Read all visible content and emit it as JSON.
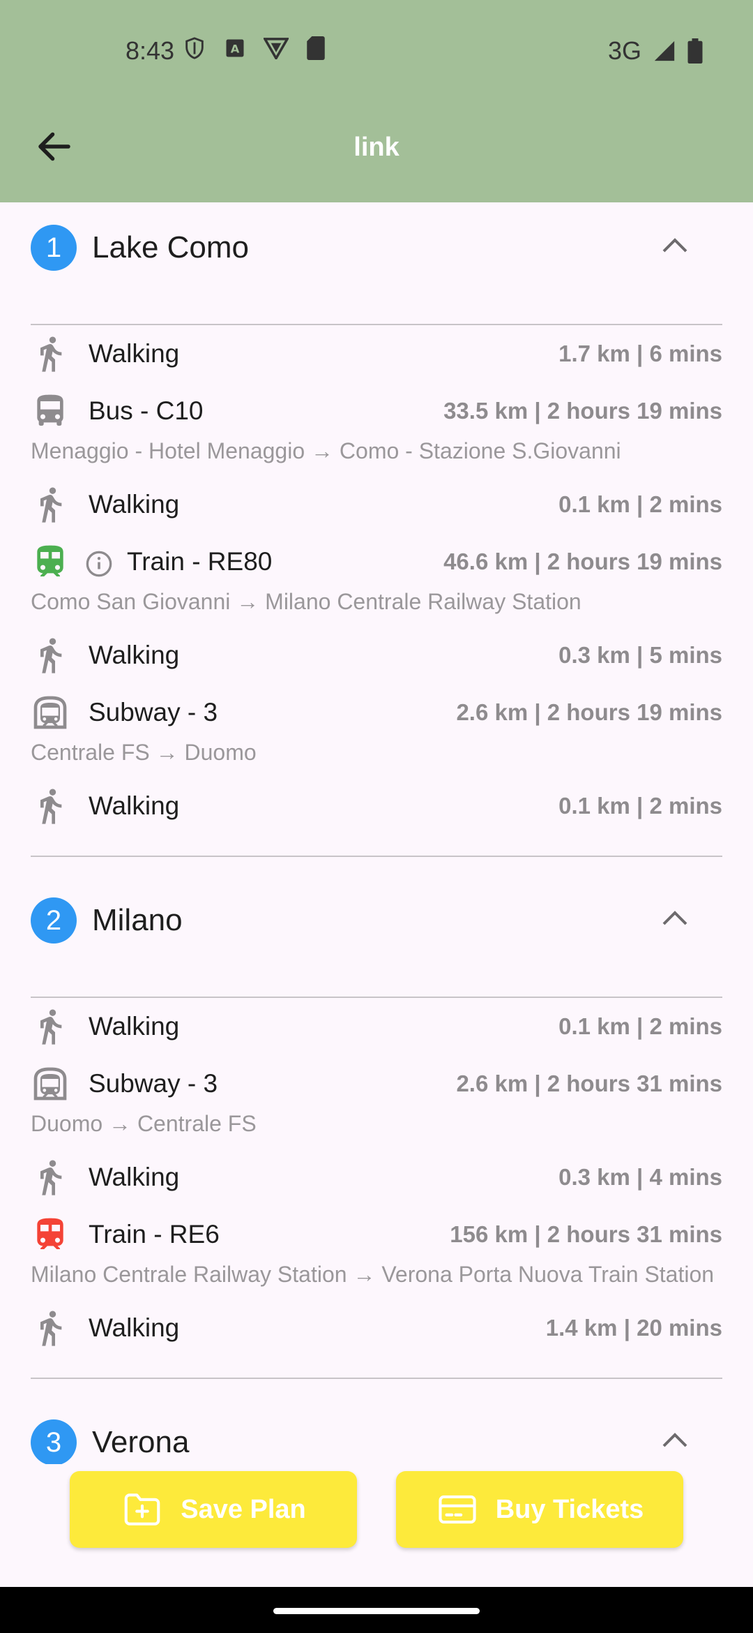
{
  "status_bar": {
    "time": "8:43",
    "network": "3G"
  },
  "app_bar": {
    "title": "link"
  },
  "sections": [
    {
      "number": "1",
      "name": "Lake Como",
      "legs": [
        {
          "mode": "Walking",
          "metric": "1.7 km | 6 mins"
        },
        {
          "mode": "Bus - C10",
          "metric": "33.5 km | 2 hours 19 mins",
          "route": "Menaggio - Hotel Menaggio → Como - Stazione S.Giovanni"
        },
        {
          "mode": "Walking",
          "metric": "0.1 km | 2 mins"
        },
        {
          "mode": "Train - RE80",
          "metric": "46.6 km | 2 hours 19 mins",
          "route": "Como San Giovanni → Milano Centrale Railway Station"
        },
        {
          "mode": "Walking",
          "metric": "0.3 km | 5 mins"
        },
        {
          "mode": "Subway - 3",
          "metric": "2.6 km | 2 hours 19 mins",
          "route": "Centrale FS → Duomo"
        },
        {
          "mode": "Walking",
          "metric": "0.1 km | 2 mins"
        }
      ]
    },
    {
      "number": "2",
      "name": "Milano",
      "legs": [
        {
          "mode": "Walking",
          "metric": "0.1 km | 2 mins"
        },
        {
          "mode": "Subway - 3",
          "metric": "2.6 km | 2 hours 31 mins",
          "route": "Duomo → Centrale FS"
        },
        {
          "mode": "Walking",
          "metric": "0.3 km | 4 mins"
        },
        {
          "mode": "Train - RE6",
          "metric": "156 km | 2 hours 31 mins",
          "route": "Milano Centrale Railway Station → Verona Porta Nuova Train Station"
        },
        {
          "mode": "Walking",
          "metric": "1.4 km | 20 mins"
        }
      ]
    },
    {
      "number": "3",
      "name": "Verona"
    }
  ],
  "actions": {
    "save_label": "Save Plan",
    "buy_label": "Buy Tickets"
  },
  "colors": {
    "app_bar": "#a3bf98",
    "badge": "#2f98f3",
    "button": "#fdea3b",
    "train_green": "#4caf50",
    "train_red": "#f44336",
    "icon_grey": "#8e8b8e"
  }
}
